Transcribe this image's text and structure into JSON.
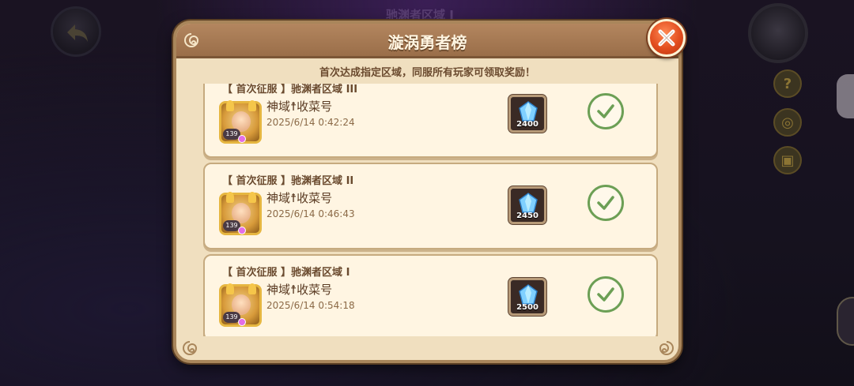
{
  "background": {
    "title": "驰渊者区域 I"
  },
  "modal": {
    "title": "漩涡勇者榜",
    "subtitle": "首次达成指定区域，同服所有玩家可领取奖励！"
  },
  "records": [
    {
      "title": "【 首次征服 】驰渊者区域 III",
      "player_name": "神域☨收菜号",
      "time": "2025/6/14 0:42:24",
      "level": "139",
      "reward_amount": "2400",
      "reward_icon": "crystal-icon",
      "claimed": true
    },
    {
      "title": "【 首次征服 】驰渊者区域 II",
      "player_name": "神域☨收菜号",
      "time": "2025/6/14 0:46:43",
      "level": "139",
      "reward_amount": "2450",
      "reward_icon": "crystal-icon",
      "claimed": true
    },
    {
      "title": "【 首次征服 】驰渊者区域 I",
      "player_name": "神域☨收菜号",
      "time": "2025/6/14 0:54:18",
      "level": "139",
      "reward_amount": "2500",
      "reward_icon": "crystal-icon",
      "claimed": true
    }
  ],
  "side_icons": [
    "?",
    "◎",
    "▣"
  ],
  "colors": {
    "accent_close": "#e24d1e",
    "check_green": "#6c9f55",
    "panel": "#f0dfbf"
  }
}
